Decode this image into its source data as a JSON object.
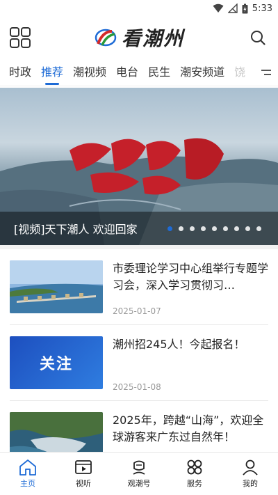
{
  "status_bar": {
    "time": "5:33"
  },
  "header": {
    "logo_text": "看潮州"
  },
  "tabs": [
    {
      "label": "时政",
      "active": false
    },
    {
      "label": "推荐",
      "active": true
    },
    {
      "label": "潮视频",
      "active": false
    },
    {
      "label": "电台",
      "active": false
    },
    {
      "label": "民生",
      "active": false
    },
    {
      "label": "潮安频道",
      "active": false
    },
    {
      "label": "饶",
      "active": false
    }
  ],
  "banner": {
    "caption": "[视频]天下潮人  欢迎回家",
    "slide_count": 9,
    "active_slide": 1
  },
  "news": [
    {
      "title": "市委理论学习中心组举行专题学习会，深入学习贯彻习…",
      "date": "2025-01-07"
    },
    {
      "title": "潮州招245人！今起报名！",
      "date": "2025-01-08",
      "thumb_text": "关注"
    },
    {
      "title": "2025年，跨越“山海”，欢迎全球游客来广东过自然年！",
      "date": ""
    }
  ],
  "bottom_nav": [
    {
      "label": "主页",
      "icon": "home-icon",
      "active": true
    },
    {
      "label": "视听",
      "icon": "video-icon",
      "active": false
    },
    {
      "label": "观潮号",
      "icon": "account-icon",
      "active": false
    },
    {
      "label": "服务",
      "icon": "service-icon",
      "active": false
    },
    {
      "label": "我的",
      "icon": "profile-icon",
      "active": false
    }
  ],
  "colors": {
    "accent": "#1e6bd6"
  }
}
